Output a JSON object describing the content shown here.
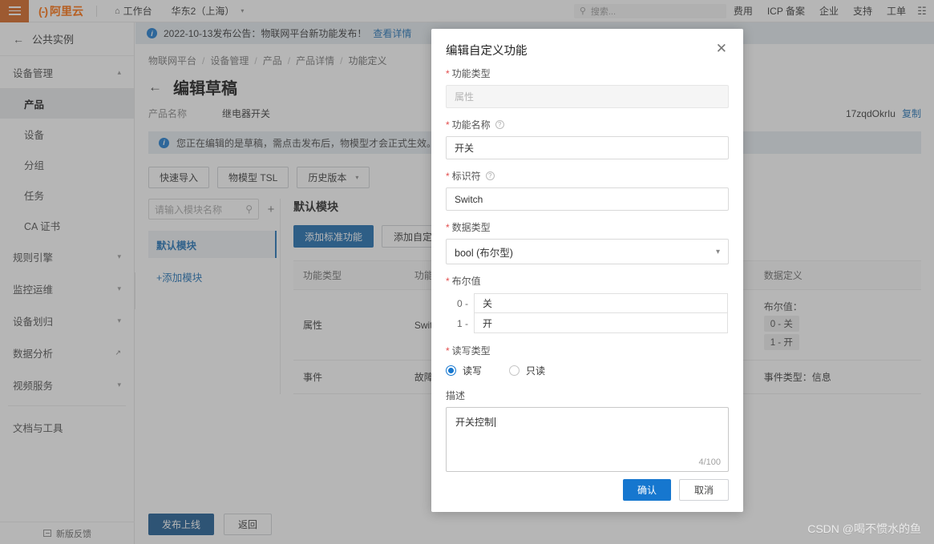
{
  "topbar": {
    "menu_icon": "hamburger-icon",
    "logo_mark": "(-)",
    "logo_text": "阿里云",
    "workbench": "工作台",
    "home_icon": "home-icon",
    "region": "华东2（上海）",
    "search_placeholder": "搜索...",
    "search_icon": "search-icon",
    "right_items": [
      "费用",
      "ICP 备案",
      "企业",
      "支持",
      "工单"
    ],
    "grid_icon": "grid-icon"
  },
  "sidebar": {
    "back_label": "公共实例",
    "back_icon": "arrow-left-icon",
    "groups": [
      {
        "label": "设备管理",
        "expanded": true,
        "chevron": "︿",
        "children": [
          {
            "label": "产品",
            "active": true
          },
          {
            "label": "设备",
            "active": false
          },
          {
            "label": "分组",
            "active": false
          },
          {
            "label": "任务",
            "active": false
          },
          {
            "label": "CA 证书",
            "active": false
          }
        ]
      },
      {
        "label": "规则引擎",
        "expanded": false,
        "chevron": "﹀",
        "children": []
      },
      {
        "label": "监控运维",
        "expanded": false,
        "chevron": "﹀",
        "children": []
      },
      {
        "label": "设备划归",
        "expanded": false,
        "chevron": "﹀",
        "children": []
      }
    ],
    "analytics": {
      "label": "数据分析",
      "external_icon": "external-link-icon"
    },
    "video": {
      "label": "视频服务",
      "chevron": "﹀"
    },
    "docs": "文档与工具",
    "footer": {
      "label": "新版反馈",
      "icon": "feedback-icon"
    },
    "collapse_icon": "chevron-left-icon"
  },
  "notice": {
    "icon": "info-icon",
    "text": "2022-10-13发布公告：物联网平台新功能发布！",
    "link": "查看详情"
  },
  "breadcrumb": [
    "物联网平台",
    "设备管理",
    "产品",
    "产品详情",
    "功能定义"
  ],
  "page": {
    "back_icon": "arrow-left-icon",
    "title": "编辑草稿",
    "meta": [
      {
        "label": "产品名称",
        "value": "继电器开关"
      }
    ],
    "product_key_tail": "17zqdOkrIu",
    "copy_label": "复制",
    "draft_tip": {
      "icon": "info-icon",
      "text": "您正在编辑的是草稿，需点击发布后，物模型才会正式生效。"
    },
    "toolbar": [
      {
        "label": "快速导入",
        "chevron": ""
      },
      {
        "label": "物模型 TSL",
        "chevron": ""
      },
      {
        "label": "历史版本",
        "chevron": "﹀"
      }
    ],
    "module_search_placeholder": "请输入模块名称",
    "module_search_icon": "search-icon",
    "module_add_icon": "plus-icon",
    "modules": [
      {
        "label": "默认模块",
        "active": true
      }
    ],
    "add_module": "+添加模块",
    "module_title": "默认模块",
    "func_buttons": [
      {
        "label": "添加标准功能",
        "primary": true
      },
      {
        "label": "添加自定义功能",
        "primary": false
      }
    ],
    "table": {
      "headers": [
        "功能类型",
        "功能名称",
        "标识符",
        "数据类型",
        "数据定义"
      ],
      "rows": [
        {
          "func_type": "属性",
          "func_name": "Switch",
          "identifier": "Switch",
          "data_type": "bool (布尔型)",
          "data_def_title": "布尔值：",
          "data_def_items": [
            "0 - 关",
            "1 - 开"
          ]
        },
        {
          "func_type": "事件",
          "func_name": "故障上报",
          "identifier": "",
          "data_type": "",
          "data_def_title": "事件类型：信息",
          "data_def_items": []
        }
      ]
    },
    "bottom_buttons": [
      {
        "label": "发布上线",
        "primary": true
      },
      {
        "label": "返回",
        "primary": false
      }
    ]
  },
  "modal": {
    "title": "编辑自定义功能",
    "close_icon": "close-icon",
    "fields": {
      "func_type": {
        "label": "功能类型",
        "required": true,
        "value": "属性",
        "disabled": true
      },
      "func_name": {
        "label": "功能名称",
        "required": true,
        "value": "开关",
        "help_icon": "question-icon"
      },
      "identifier": {
        "label": "标识符",
        "required": true,
        "value": "Switch",
        "help_icon": "question-icon"
      },
      "data_type": {
        "label": "数据类型",
        "required": true,
        "value": "bool (布尔型)",
        "chevron": "﹀"
      },
      "bool_values": {
        "label": "布尔值",
        "required": true,
        "rows": [
          {
            "key": "0 -",
            "value": "关"
          },
          {
            "key": "1 -",
            "value": "开"
          }
        ]
      },
      "rw_type": {
        "label": "读写类型",
        "required": true,
        "options": [
          {
            "label": "读写",
            "selected": true
          },
          {
            "label": "只读",
            "selected": false
          }
        ]
      },
      "description": {
        "label": "描述",
        "required": false,
        "value": "开关控制",
        "counter": "4/100"
      }
    },
    "footer": {
      "confirm": "确认",
      "cancel": "取消"
    }
  },
  "watermark": "CSDN @喝不惯水的鱼",
  "colors": {
    "brand_orange": "#d4611a",
    "logo_orange": "#ff6a00",
    "primary_blue": "#1677cf",
    "publish_blue": "#15568f",
    "link_blue": "#1a6fb5",
    "required_red": "#e34d4d"
  }
}
